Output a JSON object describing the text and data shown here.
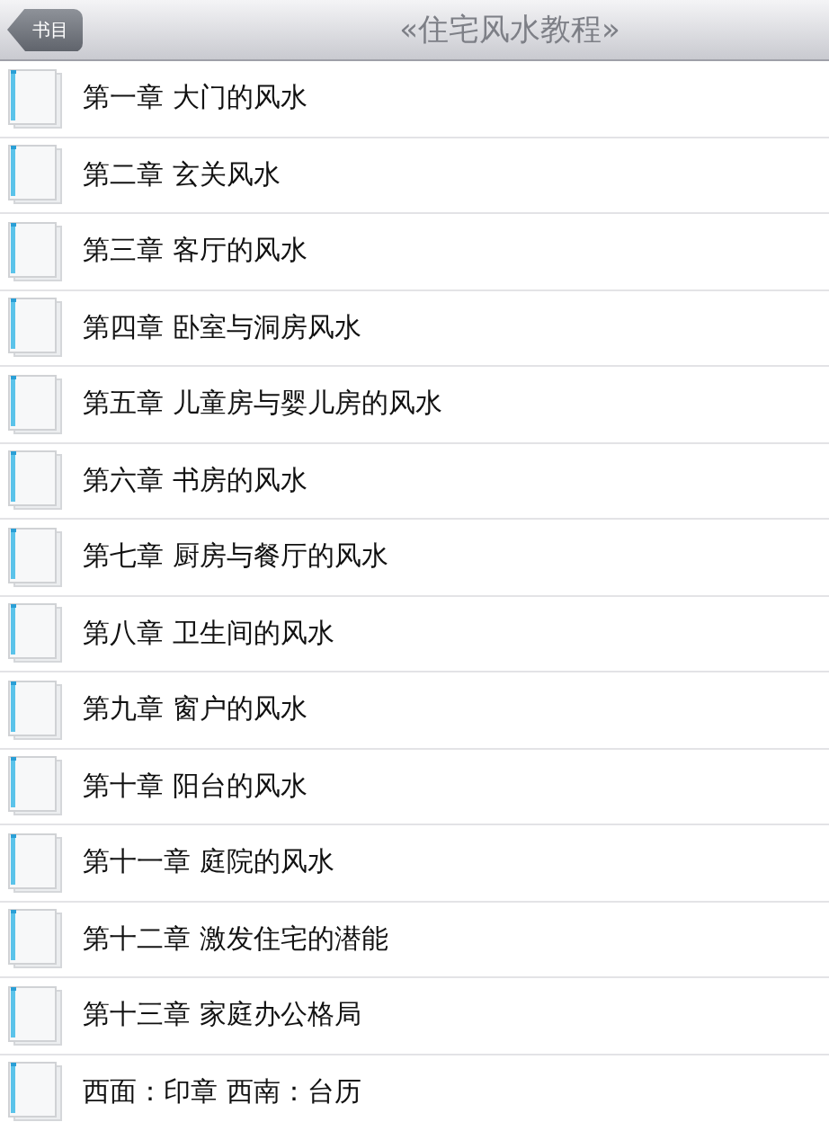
{
  "nav_bar": {
    "back_button": "书目",
    "title": "«住宅风水教程»"
  },
  "chapters": [
    {
      "title": "第一章 大门的风水"
    },
    {
      "title": "第二章 玄关风水"
    },
    {
      "title": "第三章 客厅的风水"
    },
    {
      "title": "第四章 卧室与洞房风水"
    },
    {
      "title": "第五章 儿童房与婴儿房的风水"
    },
    {
      "title": "第六章 书房的风水"
    },
    {
      "title": "第七章 厨房与餐厅的风水"
    },
    {
      "title": "第八章 卫生间的风水"
    },
    {
      "title": "第九章 窗户的风水"
    },
    {
      "title": "第十章 阳台的风水"
    },
    {
      "title": "第十一章 庭院的风水"
    },
    {
      "title": "第十二章 激发住宅的潜能"
    },
    {
      "title": "第十三章 家庭办公格局"
    },
    {
      "title": "西面：印章 西南：台历"
    }
  ]
}
